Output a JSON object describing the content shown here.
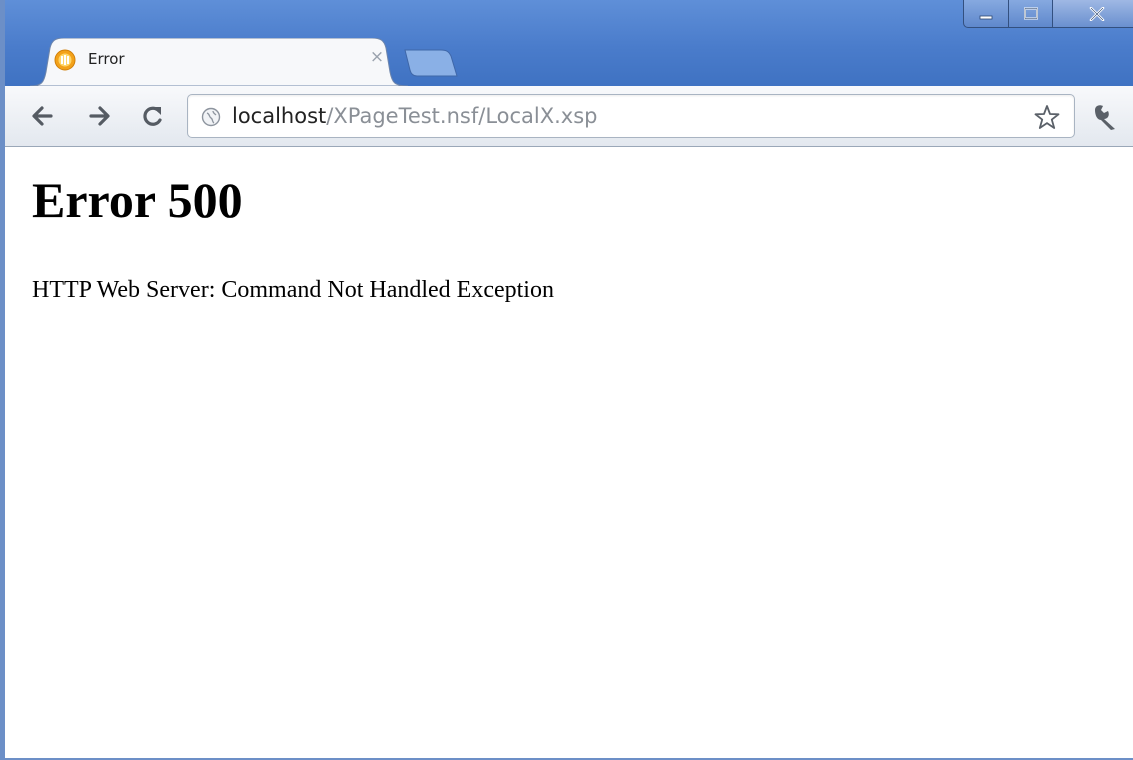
{
  "browser": {
    "tab": {
      "title": "Error",
      "favicon": "lotus-domino-icon",
      "close_label": "×"
    },
    "new_tab_icon": "new-tab-icon",
    "window_controls": {
      "minimize_icon": "minimize-icon",
      "maximize_icon": "maximize-icon",
      "close_icon": "close-icon"
    },
    "toolbar": {
      "back_icon": "arrow-left-icon",
      "forward_icon": "arrow-right-icon",
      "reload_icon": "reload-icon",
      "bookmark_icon": "star-icon",
      "menu_icon": "wrench-icon"
    },
    "omnibox": {
      "host": "localhost",
      "path": "/XPageTest.nsf/LocalX.xsp",
      "site_icon": "globe-icon"
    }
  },
  "page": {
    "heading": "Error 500",
    "message": "HTTP Web Server: Command Not Handled Exception"
  },
  "colors": {
    "titlebar": "#4a7ccb",
    "url_host": "#222222",
    "url_path": "#8a8f96"
  }
}
